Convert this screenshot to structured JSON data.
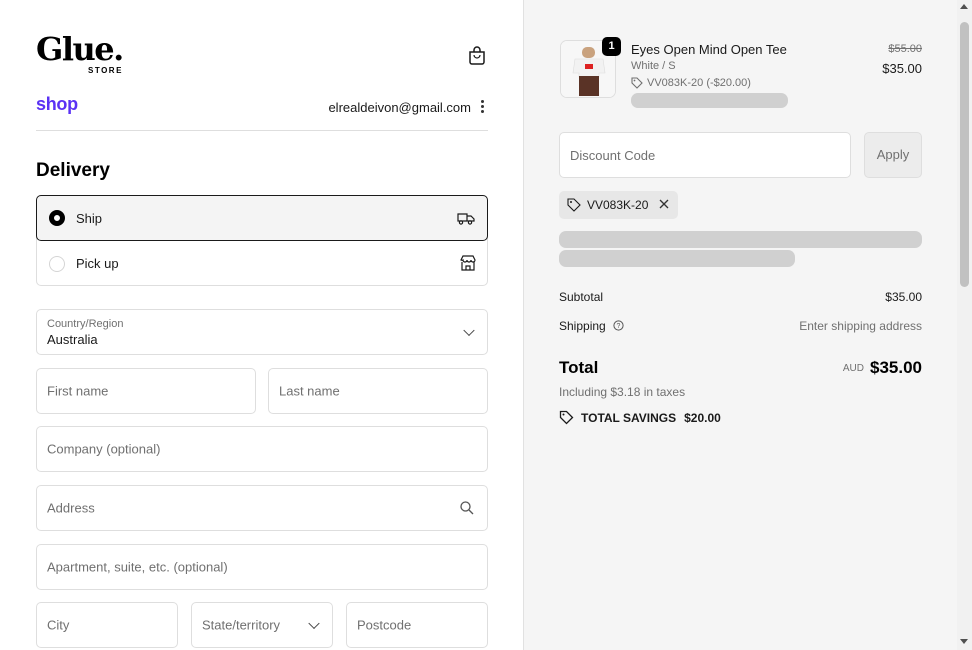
{
  "brand": {
    "logo_word": "Glue.",
    "logo_sub": "STORE"
  },
  "account": {
    "shop_label": "shop",
    "email": "elrealdeivon@gmail.com"
  },
  "delivery": {
    "heading": "Delivery",
    "options": [
      {
        "label": "Ship",
        "selected": true,
        "icon": "truck-icon"
      },
      {
        "label": "Pick up",
        "selected": false,
        "icon": "store-icon"
      }
    ]
  },
  "form": {
    "country_label": "Country/Region",
    "country_value": "Australia",
    "first_name": "First name",
    "last_name": "Last name",
    "company": "Company (optional)",
    "address": "Address",
    "apartment": "Apartment, suite, etc. (optional)",
    "city": "City",
    "state": "State/territory",
    "postcode": "Postcode"
  },
  "summary": {
    "item": {
      "quantity": "1",
      "name": "Eyes Open Mind Open Tee",
      "variant": "White / S",
      "discount_line": "VV083K-20 (-$20.00)",
      "original_price": "$55.00",
      "price": "$35.00"
    },
    "discount_placeholder": "Discount Code",
    "apply_label": "Apply",
    "applied_code": "VV083K-20",
    "subtotal_label": "Subtotal",
    "subtotal_value": "$35.00",
    "shipping_label": "Shipping",
    "shipping_value": "Enter shipping address",
    "total_label": "Total",
    "currency": "AUD",
    "total_value": "$35.00",
    "taxes_note": "Including $3.18 in taxes",
    "savings_label": "TOTAL SAVINGS",
    "savings_value": "$20.00"
  },
  "colors": {
    "shop_brand": "#5a31f4",
    "summary_bg": "#f5f5f5",
    "skeleton": "#d0d0d0"
  }
}
